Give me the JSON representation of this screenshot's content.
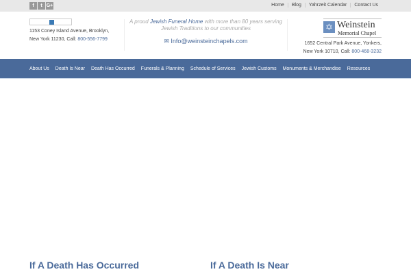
{
  "social": [
    {
      "icon": "facebook-icon",
      "glyph": "f"
    },
    {
      "icon": "twitter-icon",
      "glyph": "t"
    },
    {
      "icon": "google-plus-icon",
      "glyph": "G+"
    }
  ],
  "top_links": [
    "Home",
    "Blog",
    "Yahrzeit Calendar",
    "Contact Us"
  ],
  "left_address": {
    "line1": "1153 Coney Island Avenue, Brooklyn,",
    "line2": "New York 11230, Call: ",
    "phone": "800-556-7799"
  },
  "tagline": {
    "pre": "A proud ",
    "link": "Jewish Funeral Home",
    "post": " with more than 80 years serving",
    "line2": "Jewish Traditions to our communities"
  },
  "email": "Info@weinsteinchapels.com",
  "logo": {
    "name1": "Weinstein",
    "name2": "Memorial Chapel"
  },
  "right_address": {
    "line1": "1652 Central Park Avenue, Yonkers,",
    "line2": "New York 10710, Call: ",
    "phone": "800-468-3232"
  },
  "nav": [
    "About Us",
    "Death Is Near",
    "Death Has Occurred",
    "Funerals & Planning",
    "Schedule of Services",
    "Jewish Customs",
    "Monuments & Merchandise",
    "Resources"
  ],
  "sections": [
    "If A Death Has Occurred",
    "If A Death Is Near"
  ]
}
